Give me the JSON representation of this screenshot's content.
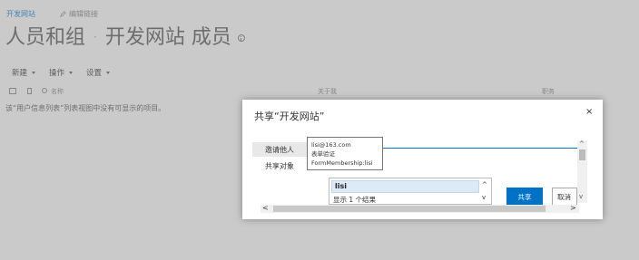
{
  "breadcrumb": {
    "site_link": "开发网站",
    "edit_links": "编辑链接"
  },
  "page_title": {
    "part1": "人员和组",
    "separator": "·",
    "part2": "开发网站 成员"
  },
  "commands": [
    {
      "label": "新建"
    },
    {
      "label": "操作"
    },
    {
      "label": "设置"
    }
  ],
  "columns": {
    "name": "名称",
    "about": "关于我",
    "role": "职务"
  },
  "list_empty_message": "该“用户信息列表”列表视图中没有可显示的项目。",
  "dialog": {
    "title": "共享“开发网站”",
    "close": "×",
    "tab_invite": "邀请他人",
    "tab_shared": "共享对象",
    "tooltip": {
      "email": "lisi@163.com",
      "auth": "表单验证",
      "membership": "FormMembership:lisi"
    },
    "picker": {
      "value": "lisi",
      "results": "显示 1 个结果"
    },
    "share_button": "共享",
    "cancel_button": "取消"
  },
  "colors": {
    "accent": "#0072c6",
    "overlay": "#969696"
  }
}
